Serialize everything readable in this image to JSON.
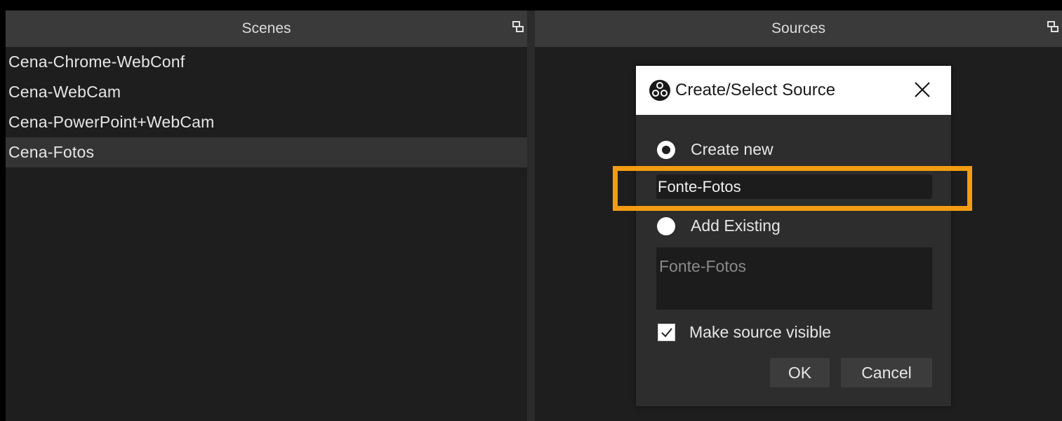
{
  "scenes": {
    "title": "Scenes",
    "items": [
      {
        "label": "Cena-Chrome-WebConf"
      },
      {
        "label": "Cena-WebCam"
      },
      {
        "label": "Cena-PowerPoint+WebCam"
      },
      {
        "label": "Cena-Fotos",
        "selected": true
      }
    ]
  },
  "sources": {
    "title": "Sources"
  },
  "dialog": {
    "title": "Create/Select Source",
    "create_new_label": "Create new",
    "create_new_checked": true,
    "name_value": "Fonte-Fotos",
    "add_existing_label": "Add Existing",
    "existing_items": [
      "Fonte-Fotos"
    ],
    "make_visible_label": "Make source visible",
    "make_visible_checked": true,
    "ok_label": "OK",
    "cancel_label": "Cancel"
  },
  "colors": {
    "highlight": "#f39c12",
    "panel_bg": "#1e1e1e",
    "header_bg": "#3a3a3a",
    "selected_bg": "#343434"
  }
}
